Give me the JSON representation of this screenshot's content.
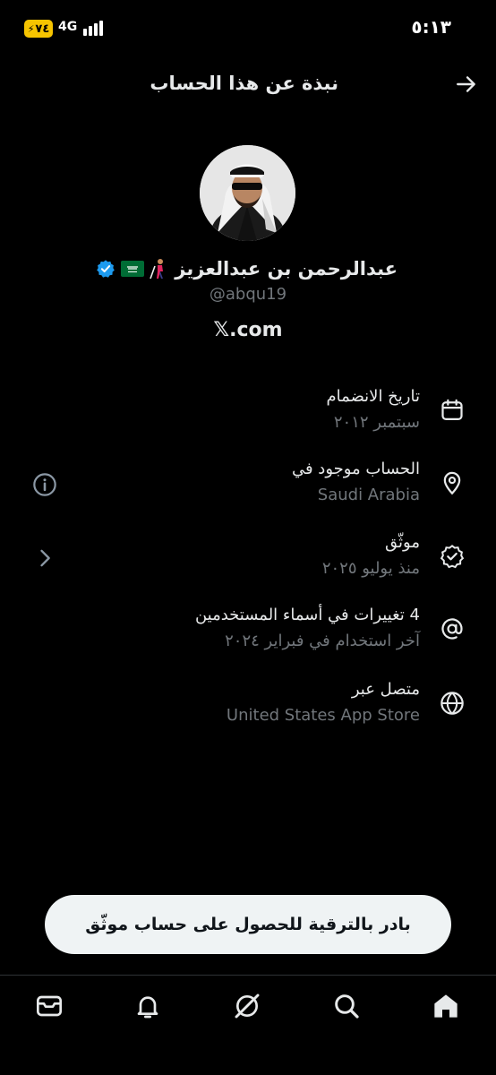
{
  "status_bar": {
    "battery_level": "٧٤",
    "network": "4G",
    "time": "٥:١٣"
  },
  "header": {
    "title": "نبذة عن هذا الحساب",
    "back_icon": "arrow-right-icon"
  },
  "profile": {
    "display_name": "عبدالرحمن بن عبدالعزيز",
    "handle": "@abqu19",
    "site_logo": "𝕏",
    "site_suffix": ".com",
    "emojis": [
      "person-with-white-cane",
      "saudi-flag"
    ],
    "verified_color": "#1d9bf0"
  },
  "info": [
    {
      "icon": "calendar-icon",
      "title": "تاريخ الانضمام",
      "subtitle": "سبتمبر ٢٠١٢"
    },
    {
      "icon": "location-pin-icon",
      "title": "الحساب موجود في",
      "subtitle": "Saudi Arabia",
      "side_icon": "info-circle-icon"
    },
    {
      "icon": "verified-badge-icon",
      "title": "موثّق",
      "subtitle": "منذ يوليو ٢٠٢٥",
      "side_icon": "chevron-left-icon"
    },
    {
      "icon": "at-sign-icon",
      "title": "4 تغييرات في أسماء المستخدمين",
      "subtitle": "آخر استخدام في فبراير ٢٠٢٤"
    },
    {
      "icon": "globe-icon",
      "title": "متصل عبر",
      "subtitle": "United States App Store"
    }
  ],
  "upgrade_button": "بادر بالترقية للحصول على حساب موثّق",
  "bottom_nav": [
    "mail-icon",
    "bell-icon",
    "grok-icon",
    "search-icon",
    "home-icon"
  ],
  "colors": {
    "background": "#000000",
    "primary_text": "#e7e9ea",
    "secondary_text": "#71767b",
    "button_bg": "#eff3f4",
    "battery": "#f6c400"
  }
}
